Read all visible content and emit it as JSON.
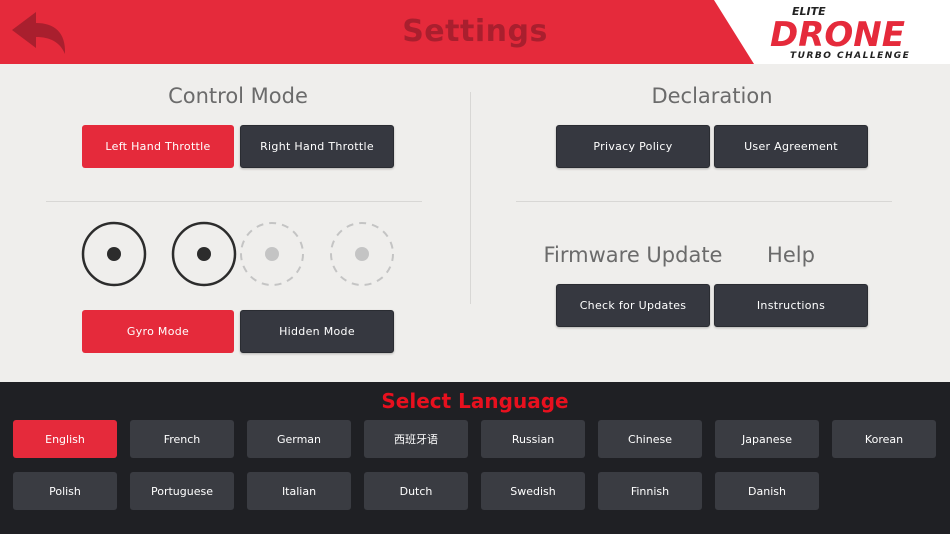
{
  "header": {
    "title": "Settings",
    "logo": {
      "top": "ELITE",
      "main": "DRONE",
      "sub": "TURBO CHALLENGE"
    }
  },
  "control_mode": {
    "title": "Control Mode",
    "left_throttle": "Left Hand Throttle",
    "right_throttle": "Right Hand Throttle",
    "gyro_mode": "Gyro Mode",
    "hidden_mode": "Hidden Mode",
    "active_throttle": "Left Hand Throttle",
    "active_mode": "Gyro Mode"
  },
  "declaration": {
    "title": "Declaration",
    "privacy": "Privacy Policy",
    "agreement": "User Agreement"
  },
  "firmware": {
    "title": "Firmware Update",
    "check": "Check for Updates"
  },
  "help": {
    "title": "Help",
    "instructions": "Instructions"
  },
  "language": {
    "title": "Select Language",
    "selected": "English",
    "row1": [
      "English",
      "French",
      "German",
      "西班牙语",
      "Russian",
      "Chinese",
      "Japanese",
      "Korean"
    ],
    "row2": [
      "Polish",
      "Portuguese",
      "Italian",
      "Dutch",
      "Swedish",
      "Finnish",
      "Danish"
    ]
  },
  "colors": {
    "accent": "#e52a3b",
    "dark_button": "#363840",
    "panel": "#1f2024",
    "language_title": "#e8101e"
  }
}
